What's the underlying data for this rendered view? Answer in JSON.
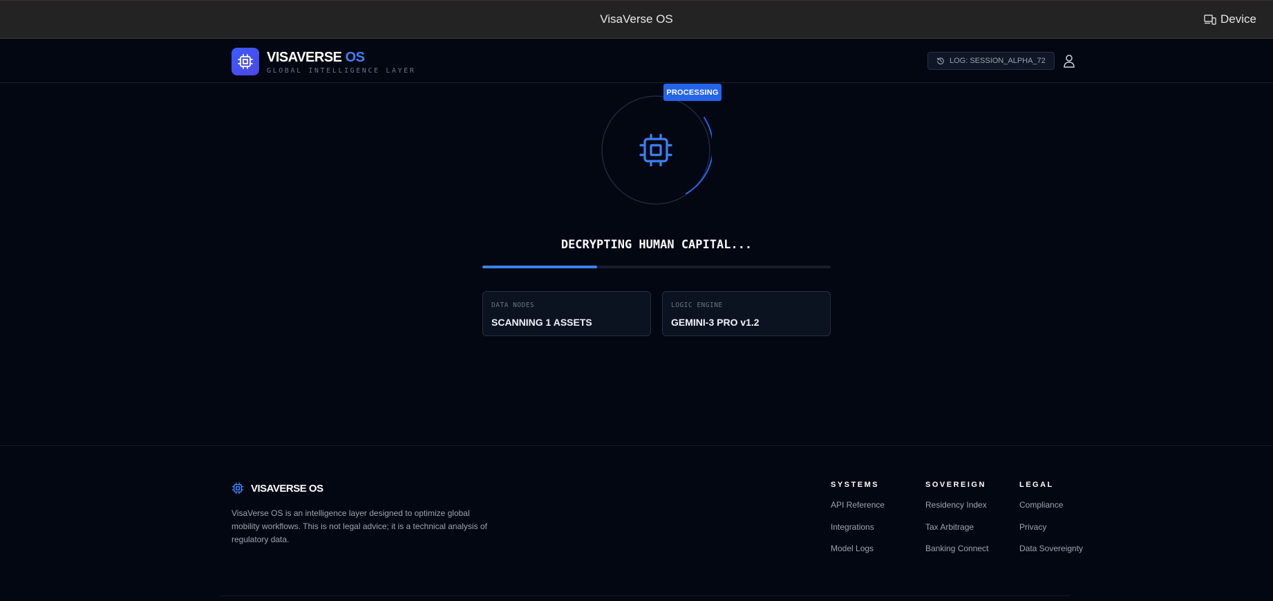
{
  "window": {
    "title": "VisaVerse OS",
    "device_label": "Device"
  },
  "header": {
    "brand_main": "VISAVERSE",
    "brand_accent": "OS",
    "subtitle": "GLOBAL INTELLIGENCE LAYER",
    "session_label": "LOG: SESSION_ALPHA_72"
  },
  "main": {
    "badge": "PROCESSING",
    "status": "DECRYPTING HUMAN CAPITAL...",
    "progress": 0.33,
    "cards": [
      {
        "label": "DATA NODES",
        "value": "SCANNING 1 ASSETS"
      },
      {
        "label": "LOGIC ENGINE",
        "value": "GEMINI-3 PRO v1.2"
      }
    ]
  },
  "footer": {
    "brand": "VISAVERSE OS",
    "description": "VisaVerse OS is an intelligence layer designed to optimize global mobility workflows. This is not legal advice; it is a technical analysis of regulatory data.",
    "columns": [
      {
        "title": "SYSTEMS",
        "links": [
          "API Reference",
          "Integrations",
          "Model Logs"
        ]
      },
      {
        "title": "SOVEREIGN",
        "links": [
          "Residency Index",
          "Tax Arbitrage",
          "Banking Connect"
        ]
      },
      {
        "title": "LEGAL",
        "links": [
          "Compliance",
          "Privacy",
          "Data Sovereignty"
        ]
      }
    ]
  },
  "colors": {
    "accent": "#3b82f6",
    "background": "#030712",
    "badge": "#2563eb"
  }
}
